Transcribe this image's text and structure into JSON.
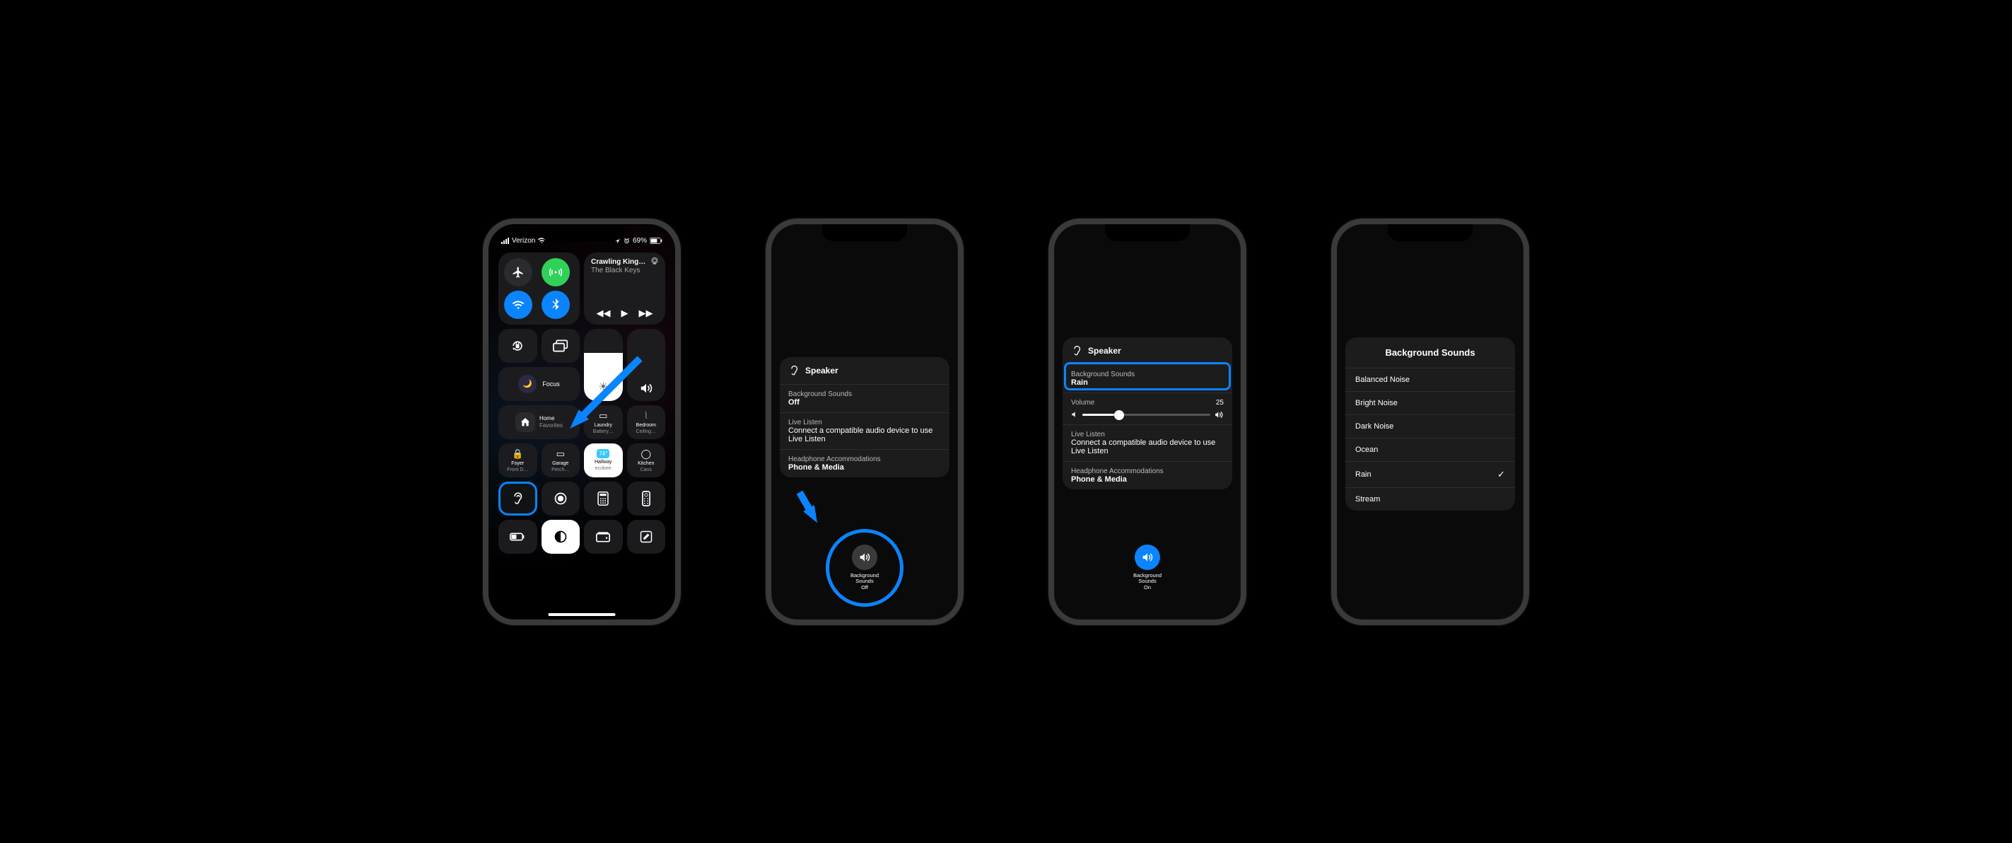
{
  "status": {
    "carrier": "Verizon",
    "battery": "69%"
  },
  "control_center": {
    "music": {
      "title": "Crawling King…",
      "artist": "The Black Keys"
    },
    "focus_label": "Focus",
    "home": {
      "title": "Home",
      "sub": "Favorites"
    },
    "tiles": {
      "laundry": {
        "l1": "Laundry",
        "l2": "Battery…"
      },
      "bedroom": {
        "l1": "Bedroom",
        "l2": "Ceiling…"
      },
      "foyer": {
        "l1": "Foyer",
        "l2": "Front D…"
      },
      "garage": {
        "l1": "Garage",
        "l2": "Perch…"
      },
      "hallway": {
        "l1": "Hallway",
        "l2": "ecobee",
        "badge": "74°"
      },
      "kitchen": {
        "l1": "Kitchen",
        "l2": "Cans"
      }
    }
  },
  "hearing_off": {
    "device": "Speaker",
    "bg_label": "Background Sounds",
    "bg_value": "Off",
    "live_label": "Live Listen",
    "live_msg": "Connect a compatible audio device to use Live Listen",
    "acc_label": "Headphone Accommodations",
    "acc_value": "Phone & Media",
    "btn_label": "Background\nSounds",
    "btn_state": "Off"
  },
  "hearing_on": {
    "device": "Speaker",
    "bg_label": "Background Sounds",
    "bg_value": "Rain",
    "vol_label": "Volume",
    "vol_value": "25",
    "live_label": "Live Listen",
    "live_msg": "Connect a compatible audio device to use Live Listen",
    "acc_label": "Headphone Accommodations",
    "acc_value": "Phone & Media",
    "btn_label": "Background\nSounds",
    "btn_state": "On"
  },
  "sounds_list": {
    "title": "Background Sounds",
    "items": [
      "Balanced Noise",
      "Bright Noise",
      "Dark Noise",
      "Ocean",
      "Rain",
      "Stream"
    ],
    "selected": "Rain"
  }
}
